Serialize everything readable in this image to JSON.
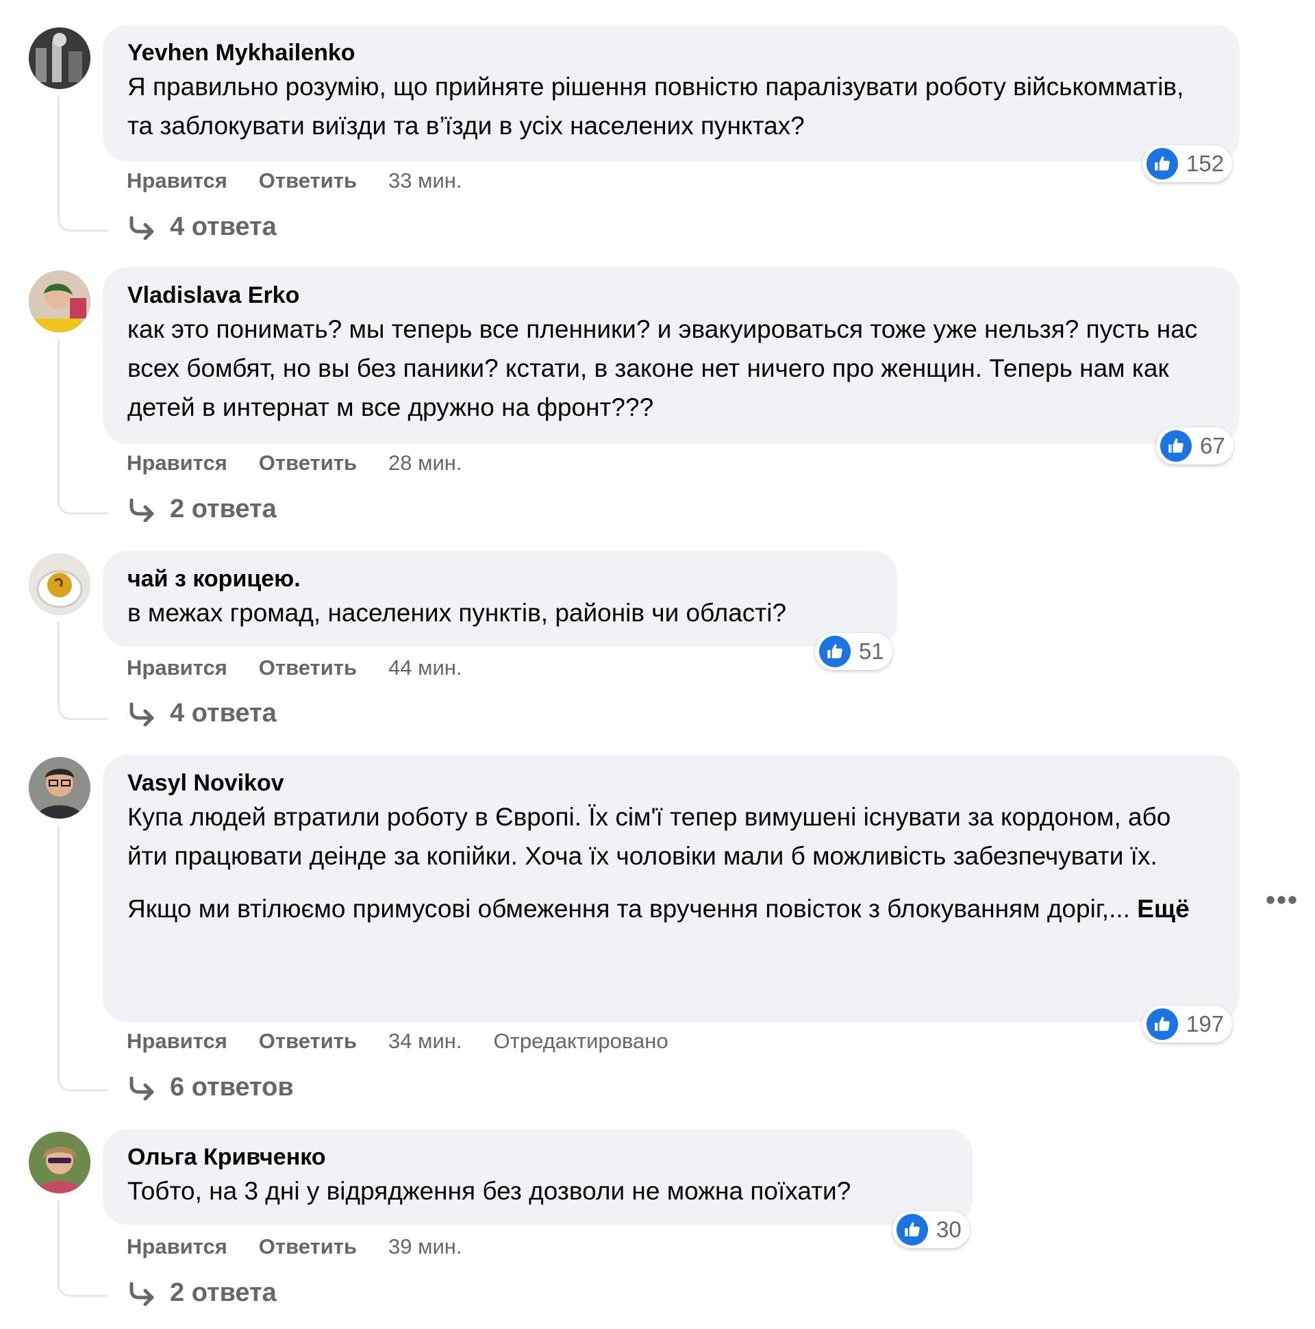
{
  "actions": {
    "like_label": "Нравится",
    "reply_label": "Ответить",
    "edited_label": "Отредактировано",
    "more_label": "Ещё"
  },
  "comments": [
    {
      "author": "Yevhen Mykhailenko",
      "text": [
        "Я правильно розумію, що прийняте рішення повністю паралізувати роботу військомматів, та заблокувати виїзди та в’їзди в усіх населених пунктах?"
      ],
      "time": "33 мин.",
      "likes": "152",
      "replies": "4 ответа"
    },
    {
      "author": "Vladislava Erko",
      "text": [
        "как это понимать? мы теперь все пленники? и эвакуироваться тоже уже нельзя? пусть нас всех бомбят, но вы без паники? кстати, в законе нет ничего про женщин. Теперь нам как детей в интернат м все дружно на фронт???"
      ],
      "time": "28 мин.",
      "likes": "67",
      "replies": "2 ответа"
    },
    {
      "author": "чай з корицею.",
      "text": [
        "в межах громад, населених пунктів, районів чи області?"
      ],
      "time": "44 мин.",
      "likes": "51",
      "replies": "4 ответа"
    },
    {
      "author": "Vasyl Novikov",
      "text": [
        "Купа людей втратили роботу в Європі. Їх сім'ї тепер вимушені існувати за кордоном, або йти працювати деінде за копійки. Хоча їх чоловіки мали б можливість забезпечувати їх.",
        "Якщо ми втілюємо примусові обмеження та вручення повісток з блокуванням доріг,..."
      ],
      "time": "34 мин.",
      "likes": "197",
      "replies": "6 ответов",
      "edited": true
    },
    {
      "author": "Ольга Кривченко",
      "text": [
        "Тобто, на 3 дні у відрядження без дозволи не можна поїхати?"
      ],
      "time": "39 мин.",
      "likes": "30",
      "replies": "2 ответа"
    }
  ],
  "icons": {
    "like": "thumbs-up-icon",
    "reply": "reply-arrow-icon",
    "more": "more-options-icon"
  },
  "colors": {
    "bubble": "#f0f2f5",
    "secondary_text": "#65676b",
    "like_blue": "#1b74e4"
  },
  "more_options_glyph": "•••"
}
